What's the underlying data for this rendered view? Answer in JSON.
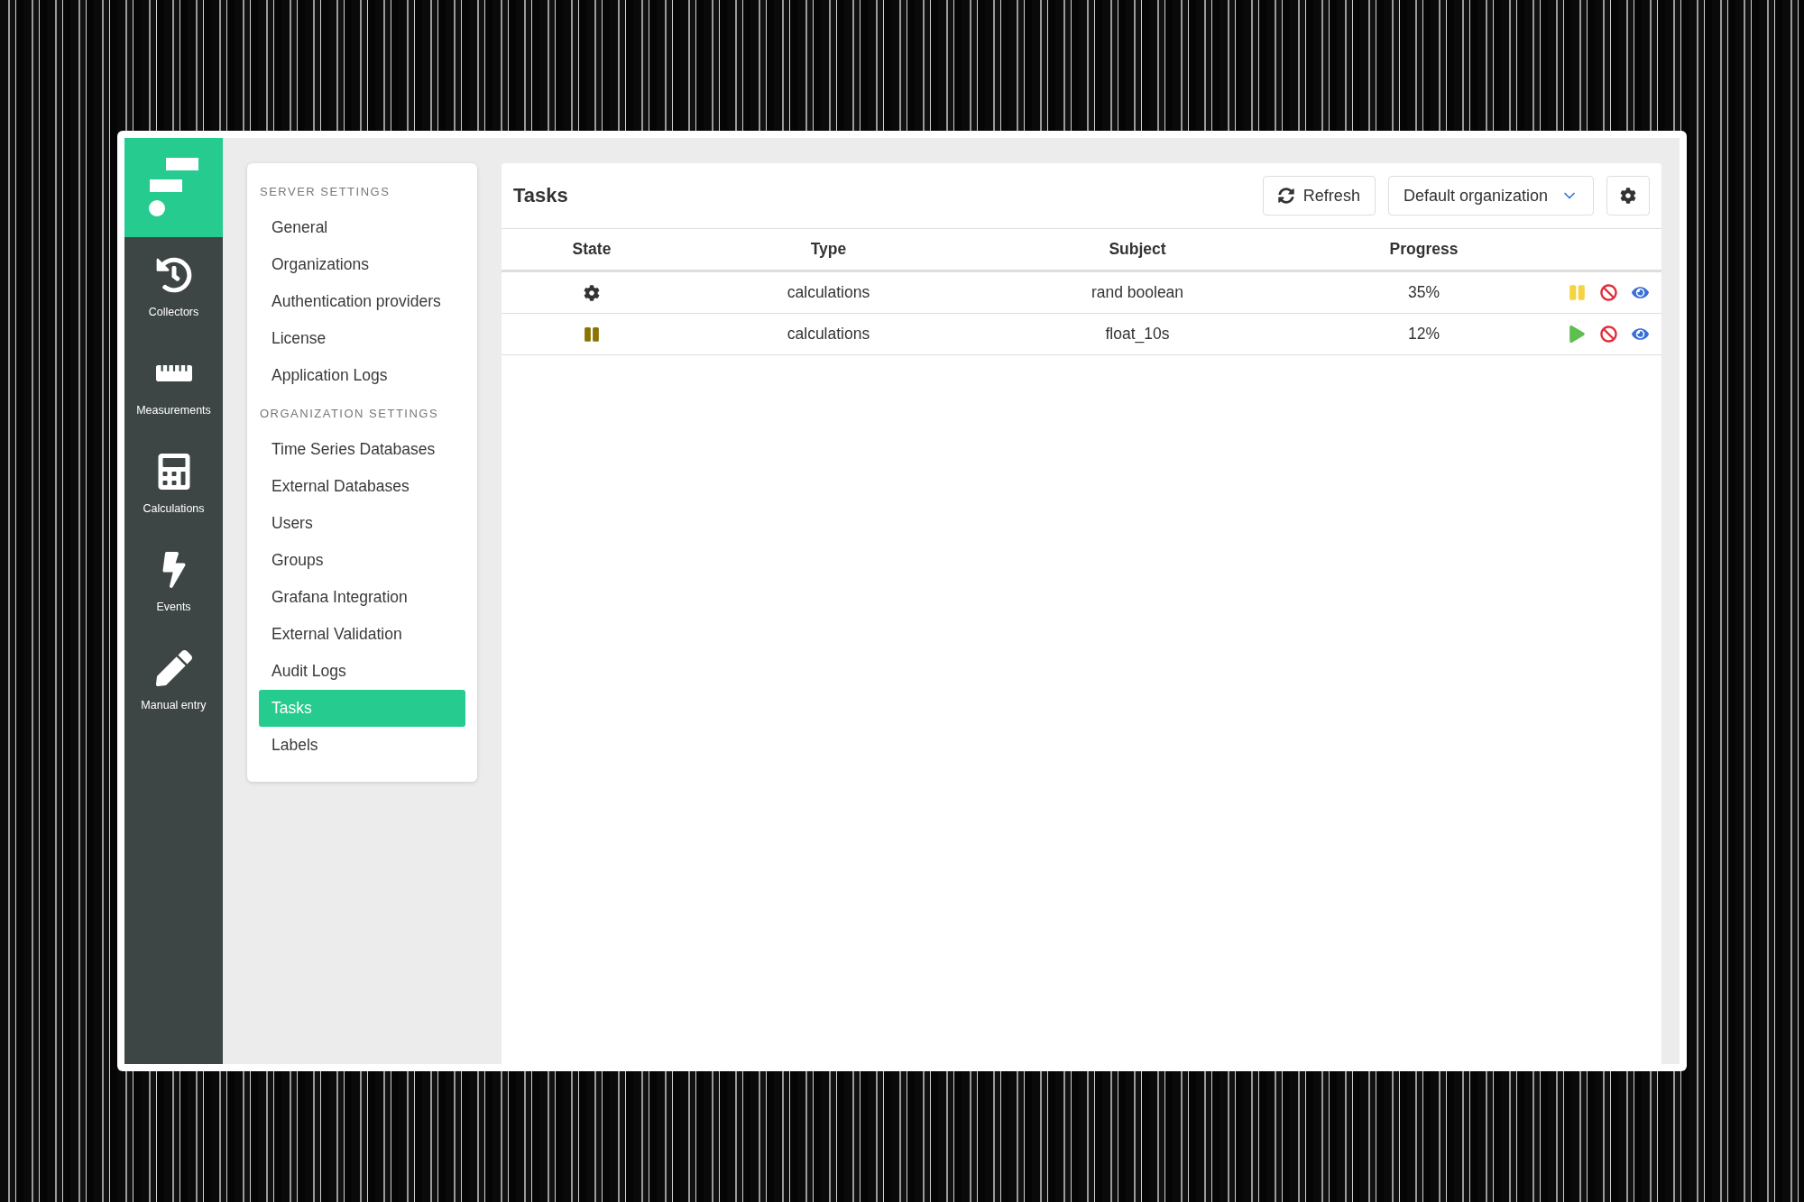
{
  "nav": {
    "items": [
      {
        "label": "Collectors"
      },
      {
        "label": "Measurements"
      },
      {
        "label": "Calculations"
      },
      {
        "label": "Events"
      },
      {
        "label": "Manual entry"
      }
    ]
  },
  "settings_menu": {
    "sections": [
      {
        "heading": "SERVER SETTINGS",
        "items": [
          {
            "label": "General",
            "selected": false
          },
          {
            "label": "Organizations",
            "selected": false
          },
          {
            "label": "Authentication providers",
            "selected": false
          },
          {
            "label": "License",
            "selected": false
          },
          {
            "label": "Application Logs",
            "selected": false
          }
        ]
      },
      {
        "heading": "ORGANIZATION SETTINGS",
        "items": [
          {
            "label": "Time Series Databases",
            "selected": false
          },
          {
            "label": "External Databases",
            "selected": false
          },
          {
            "label": "Users",
            "selected": false
          },
          {
            "label": "Groups",
            "selected": false
          },
          {
            "label": "Grafana Integration",
            "selected": false
          },
          {
            "label": "External Validation",
            "selected": false
          },
          {
            "label": "Audit Logs",
            "selected": false
          },
          {
            "label": "Tasks",
            "selected": true
          },
          {
            "label": "Labels",
            "selected": false
          }
        ]
      }
    ]
  },
  "panel": {
    "title": "Tasks",
    "refresh_button": "Refresh",
    "organization_select": "Default organization"
  },
  "table": {
    "columns": [
      "State",
      "Type",
      "Subject",
      "Progress"
    ],
    "rows": [
      {
        "kind": "running",
        "type": "calculations",
        "subject": "rand boolean",
        "progress": "35%"
      },
      {
        "kind": "paused",
        "type": "calculations",
        "subject": "float_10s",
        "progress": "12%"
      }
    ]
  }
}
